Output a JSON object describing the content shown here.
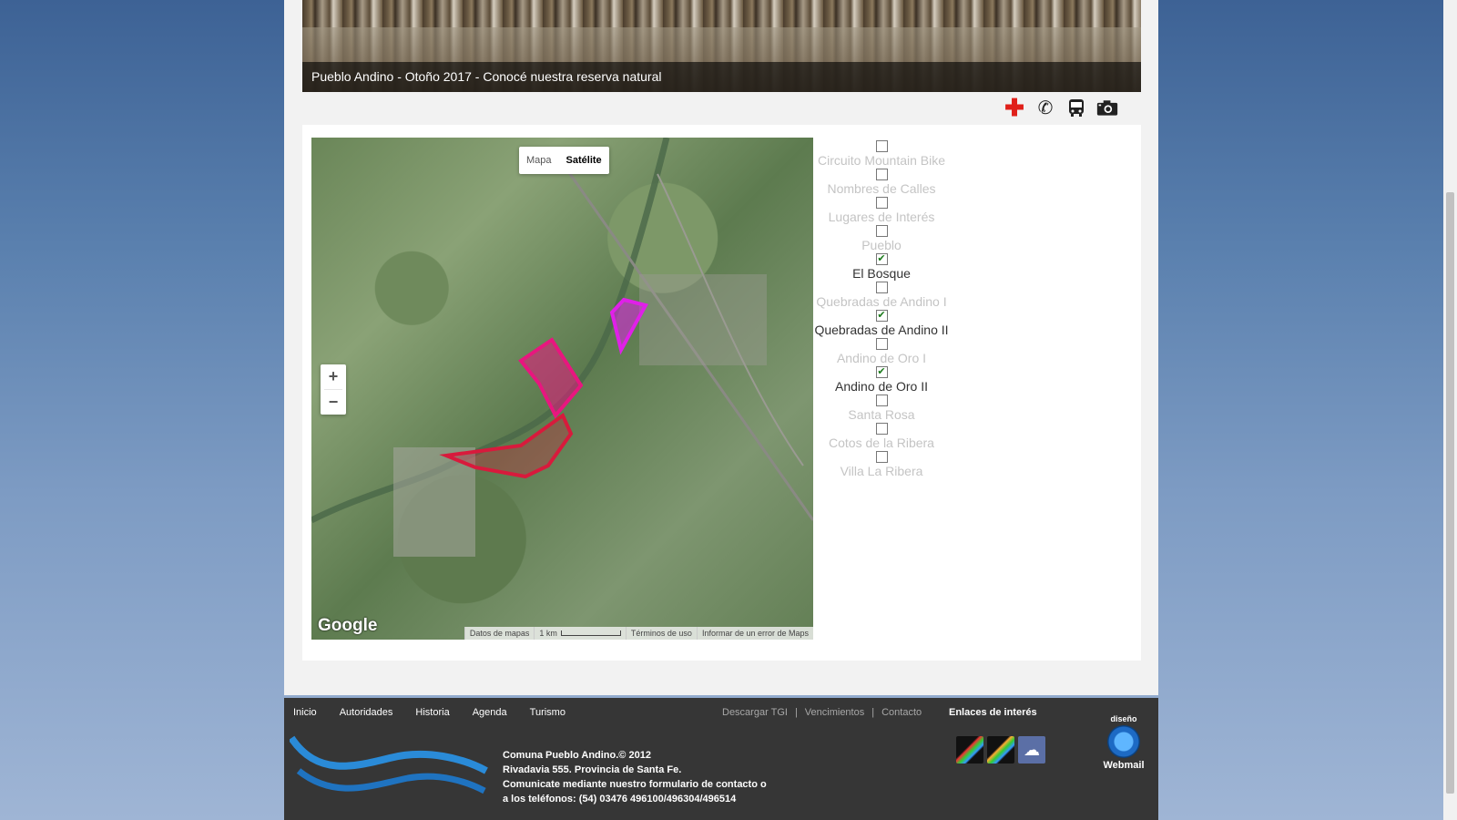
{
  "banner": {
    "caption": "Pueblo Andino - Otoño 2017 - Conocé nuestra reserva natural"
  },
  "toolbar": {
    "icons": [
      "red-cross-icon",
      "phone-icon",
      "bus-icon",
      "camera-icon"
    ]
  },
  "map": {
    "type_buttons": {
      "map": "Mapa",
      "satellite": "Satélite"
    },
    "zoom": {
      "in": "+",
      "out": "−"
    },
    "logo": "Google",
    "footer": {
      "data": "Datos de mapas",
      "scale": "1 km",
      "terms": "Términos de uso",
      "report": "Informar de un error de Maps"
    }
  },
  "layers": [
    {
      "label": "Circuito Mountain Bike",
      "checked": false
    },
    {
      "label": "Nombres de Calles",
      "checked": false
    },
    {
      "label": "Lugares de Interés",
      "checked": false
    },
    {
      "label": "Pueblo",
      "checked": false
    },
    {
      "label": "El Bosque",
      "checked": true
    },
    {
      "label": "Quebradas de Andino I",
      "checked": false
    },
    {
      "label": "Quebradas de Andino II",
      "checked": true
    },
    {
      "label": "Andino de Oro I",
      "checked": false
    },
    {
      "label": "Andino de Oro II",
      "checked": true
    },
    {
      "label": "Santa Rosa",
      "checked": false
    },
    {
      "label": "Cotos de la Ribera",
      "checked": false
    },
    {
      "label": "Villa La Ribera",
      "checked": false
    }
  ],
  "footer": {
    "nav": [
      "Inicio",
      "Autoridades",
      "Historia",
      "Agenda",
      "Turismo"
    ],
    "nav2": [
      "Descargar TGI",
      "|",
      "Vencimientos",
      "|",
      "Contacto"
    ],
    "enlaces_title": "Enlaces de interés",
    "info": [
      "Comuna Pueblo Andino.© 2012",
      "Rivadavia 555. Provincia de Santa Fe.",
      "Comunicate mediante nuestro formulario de contacto o",
      "a los teléfonos: (54) 03476 496100/496304/496514"
    ],
    "webmail_top": "diseño",
    "webmail": "Webmail"
  },
  "colors": {
    "polygon_pink": "#e8167f",
    "polygon_magenta": "#e020e8",
    "polygon_red": "#d81a3c"
  }
}
